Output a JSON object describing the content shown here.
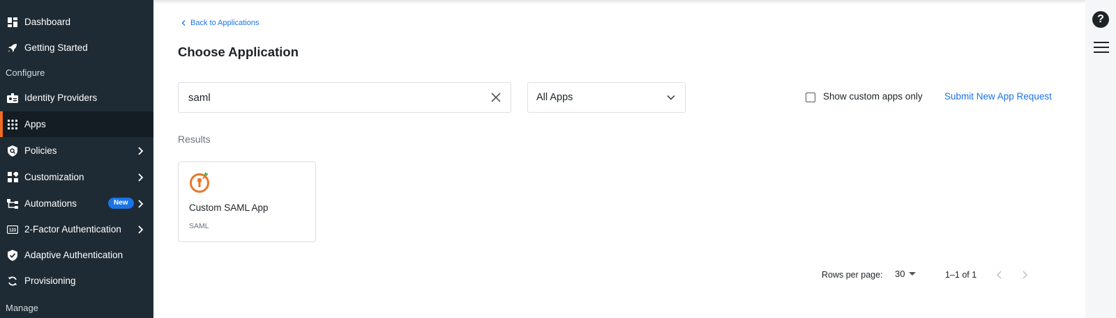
{
  "sidebar": {
    "items": [
      {
        "label": "Dashboard",
        "icon": "dashboard-icon"
      },
      {
        "label": "Getting Started",
        "icon": "rocket-icon"
      },
      {
        "label": "Identity Providers",
        "icon": "id-card-icon"
      },
      {
        "label": "Apps",
        "icon": "apps-grid-icon",
        "active": true
      },
      {
        "label": "Policies",
        "icon": "policy-shield-icon"
      },
      {
        "label": "Customization",
        "icon": "customization-icon"
      },
      {
        "label": "Automations",
        "icon": "automation-icon",
        "badge": "New"
      },
      {
        "label": "2-Factor Authentication",
        "icon": "123-icon"
      },
      {
        "label": "Adaptive Authentication",
        "icon": "shield-check-icon"
      },
      {
        "label": "Provisioning",
        "icon": "sync-icon"
      }
    ],
    "sections": {
      "configure": "Configure",
      "manage": "Manage"
    }
  },
  "main": {
    "back_link": "Back to Applications",
    "title": "Choose Application",
    "search": {
      "value": "saml"
    },
    "filter": {
      "selected": "All Apps"
    },
    "custom_only_label": "Show custom apps only",
    "submit_link": "Submit New App Request",
    "results_label": "Results",
    "apps": [
      {
        "name": "Custom SAML App",
        "tag": "SAML"
      }
    ],
    "pagination": {
      "rows_per_page_label": "Rows per page:",
      "rows_per_page": "30",
      "range": "1–1 of 1"
    }
  },
  "right_rail": {
    "help": "?"
  },
  "colors": {
    "sidebar_bg": "#1f2b34",
    "accent": "#f26b21",
    "link": "#1a73e8"
  }
}
